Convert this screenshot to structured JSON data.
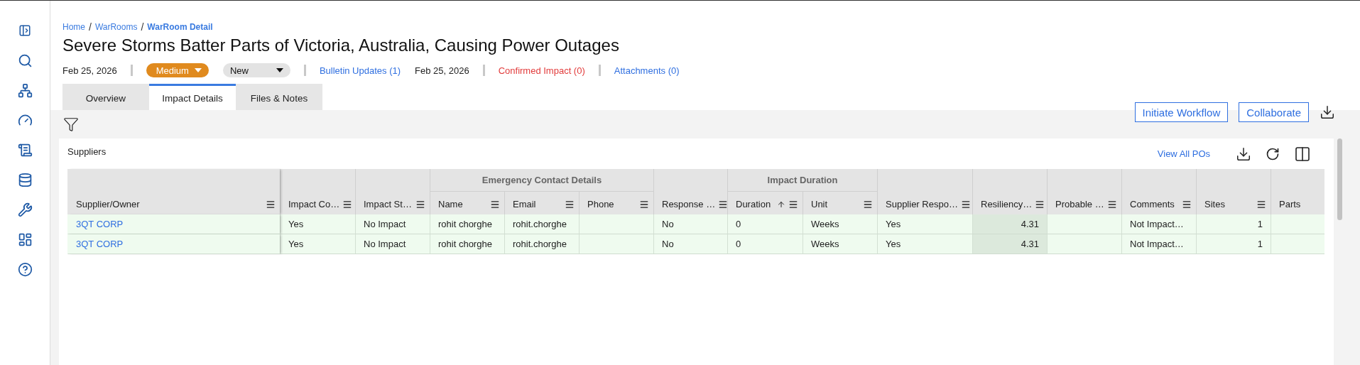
{
  "breadcrumb": [
    {
      "label": "Home",
      "current": false
    },
    {
      "label": "WarRooms",
      "current": false
    },
    {
      "label": "WarRoom Detail",
      "current": true
    }
  ],
  "breadcrumb_separators": [
    "/",
    "/"
  ],
  "title": "Severe Storms Batter Parts of Victoria, Australia, Causing Power Outages",
  "meta_groups": [
    [
      {
        "kind": "text",
        "text": "Feb 25, 2026"
      }
    ],
    [
      {
        "kind": "dropdown",
        "highlighted": true,
        "text": "Medium"
      },
      {
        "kind": "dropdown",
        "highlighted": false,
        "text": "New"
      }
    ],
    [
      {
        "kind": "link",
        "alert": false,
        "text": "Bulletin Updates (1)"
      },
      {
        "kind": "text",
        "text": "Feb 25, 2026"
      }
    ],
    [
      {
        "kind": "link",
        "alert": true,
        "text": "Confirmed Impact (0)"
      }
    ],
    [
      {
        "kind": "link",
        "alert": false,
        "text": "Attachments (0)"
      }
    ]
  ],
  "tabs": [
    {
      "label": "Overview",
      "selected": false
    },
    {
      "label": "Impact Details",
      "selected": true
    },
    {
      "label": "Files & Notes",
      "selected": false
    }
  ],
  "actions": [
    "Initiate Workflow",
    "Collaborate"
  ],
  "card": {
    "title": "Suppliers",
    "link": "View All POs"
  },
  "table": {
    "header": [
      {
        "kind": "column",
        "label": "Supplier/Owner",
        "menu": true,
        "pinned": true
      },
      {
        "kind": "column",
        "label": "Impact Co…",
        "menu": true
      },
      {
        "kind": "column",
        "label": "Impact St…",
        "menu": true
      },
      {
        "kind": "group",
        "label": "Emergency Contact Details",
        "columns": [
          {
            "label": "Name",
            "menu": true
          },
          {
            "label": "Email",
            "menu": true
          },
          {
            "label": "Phone",
            "menu": true
          }
        ]
      },
      {
        "kind": "column",
        "label": "Response …",
        "menu": true
      },
      {
        "kind": "group",
        "label": "Impact Duration",
        "columns": [
          {
            "label": "Duration",
            "menu": true,
            "sorted": true
          },
          {
            "label": "Unit",
            "menu": true
          }
        ]
      },
      {
        "kind": "column",
        "label": "Supplier Respo…",
        "menu": true
      },
      {
        "kind": "column",
        "label": "Resiliency…",
        "menu": true,
        "shaded": true,
        "numeric": true
      },
      {
        "kind": "column",
        "label": "Probable …",
        "menu": true
      },
      {
        "kind": "column",
        "label": "Comments",
        "menu": true
      },
      {
        "kind": "column",
        "label": "Sites",
        "menu": true,
        "numeric": true
      },
      {
        "kind": "column",
        "label": "Parts",
        "menu": false
      }
    ],
    "rows": [
      [
        "3QT CORP",
        "Yes",
        "No Impact",
        "rohit chorghe",
        "rohit.chorghe",
        "",
        "No",
        "0",
        "Weeks",
        "Yes",
        "4.31",
        "",
        "Not Impact…",
        "1",
        ""
      ],
      [
        "3QT CORP",
        "Yes",
        "No Impact",
        "rohit chorghe",
        "rohit.chorghe",
        "",
        "No",
        "0",
        "Weeks",
        "Yes",
        "4.31",
        "",
        "Not Impact…",
        "1",
        ""
      ]
    ]
  }
}
